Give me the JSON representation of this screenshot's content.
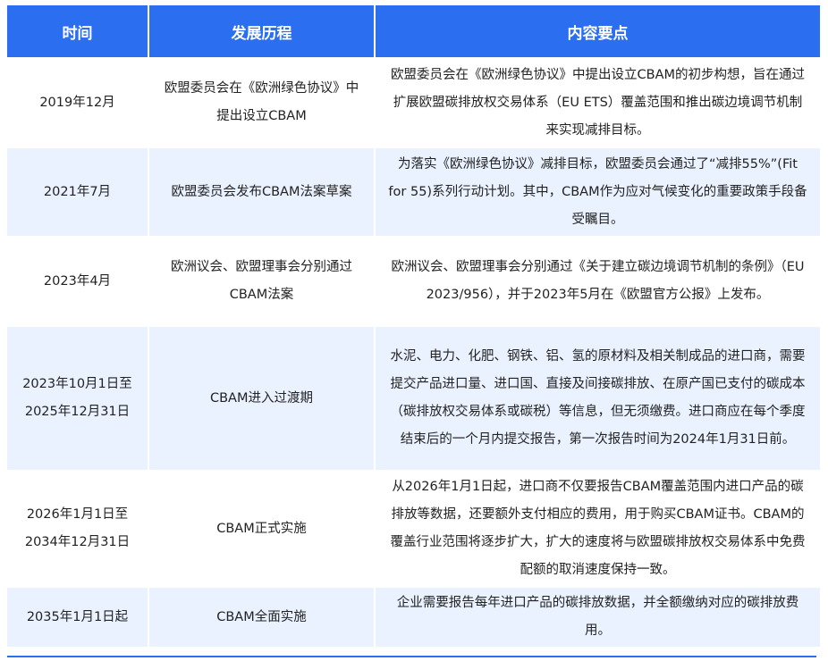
{
  "table": {
    "headers": [
      "时间",
      "发展历程",
      "内容要点"
    ],
    "rows": [
      {
        "time": "2019年12月",
        "history": "欧盟委员会在《欧洲绿色协议》中提出设立CBAM",
        "content": "欧盟委员会在《欧洲绿色协议》中提出设立CBAM的初步构想，旨在通过扩展欧盟碳排放权交易体系（EU ETS）覆盖范围和推出碳边境调节机制来实现减排目标。"
      },
      {
        "time": "2021年7月",
        "history": "欧盟委员会发布CBAM法案草案",
        "content": "为落实《欧洲绿色协议》减排目标，欧盟委员会通过了“减排55%”(Fit for 55)系列行动计划。其中，CBAM作为应对气候变化的重要政策手段备受瞩目。"
      },
      {
        "time": "2023年4月",
        "history": "欧洲议会、欧盟理事会分别通过CBAM法案",
        "content": "欧洲议会、欧盟理事会分别通过《关于建立碳边境调节机制的条例》（EU 2023/956），并于2023年5月在《欧盟官方公报》上发布。"
      },
      {
        "time": "2023年10月1日至2025年12月31日",
        "history": "CBAM进入过渡期",
        "content": "水泥、电力、化肥、钢铁、铝、氢的原材料及相关制成品的进口商，需要提交产品进口量、进口国、直接及间接碳排放、在原产国已支付的碳成本（碳排放权交易体系或碳税）等信息，但无须缴费。进口商应在每个季度结束后的一个月内提交报告，第一次报告时间为2024年1月31日前。"
      },
      {
        "time": "2026年1月1日至2034年12月31日",
        "history": "CBAM正式实施",
        "content": "从2026年1月1日起，进口商不仅要报告CBAM覆盖范围内进口产品的碳排放等数据，还要额外支付相应的费用，用于购买CBAM证书。CBAM的覆盖行业范围将逐步扩大，扩大的速度将与欧盟碳排放权交易体系中免费配额的取消速度保持一致。"
      },
      {
        "time": "2035年1月1日起",
        "history": "CBAM全面实施",
        "content": "企业需要报告每年进口产品的碳排放数据，并全额缴纳对应的碳排放费用。"
      }
    ]
  },
  "colors": {
    "header_bg": "#2b6ff0",
    "alt_row_bg": "#eaf2ff"
  }
}
